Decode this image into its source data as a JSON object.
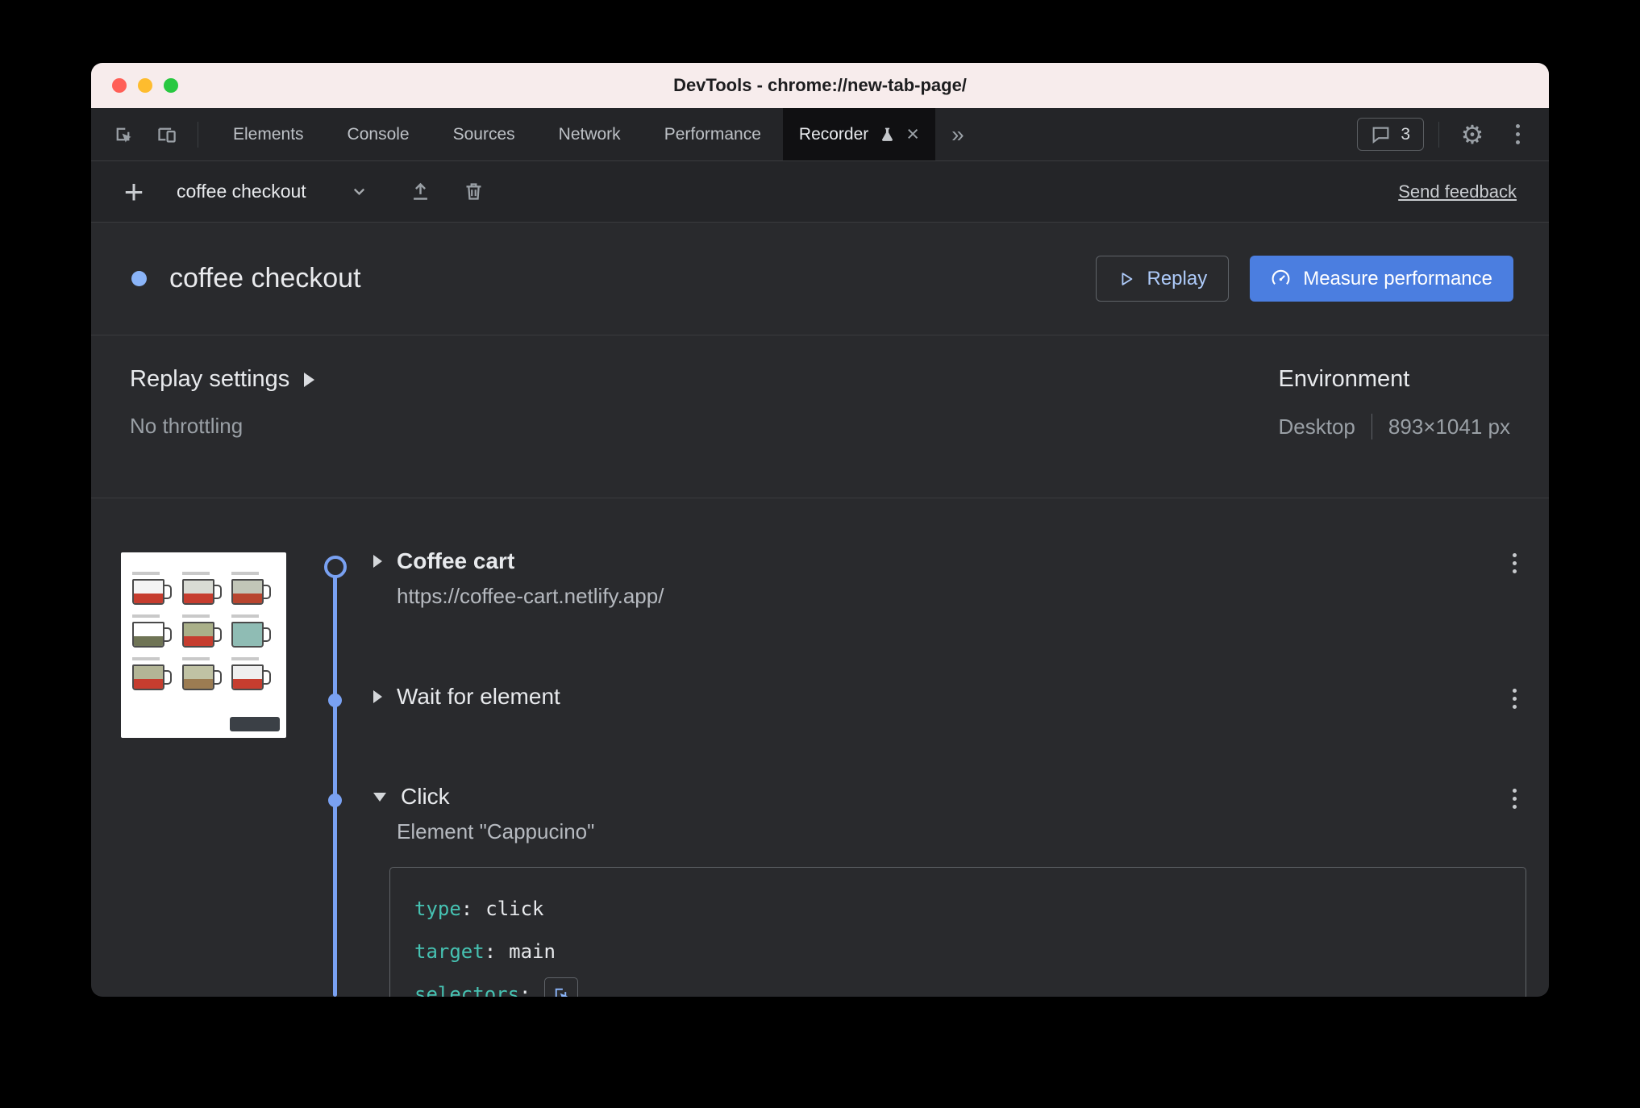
{
  "colors": {
    "accent_blue": "#8ab4f8",
    "primary_button": "#4b7ee0",
    "timeline_blue": "#79a1f2",
    "key_teal": "#46c2b2",
    "titlebar_bg": "#f7ecec",
    "traffic_red": "#ff5f57",
    "traffic_yellow": "#febc2e",
    "traffic_green": "#28c840"
  },
  "window": {
    "title": "DevTools - chrome://new-tab-page/"
  },
  "icons": {
    "add": "+",
    "more_tabs": "»",
    "close_tab": "×",
    "gear": "⚙"
  },
  "tabbar": {
    "tabs": [
      "Elements",
      "Console",
      "Sources",
      "Network",
      "Performance"
    ],
    "active_tab": "Recorder",
    "message_count": "3"
  },
  "toolbar": {
    "recording_name": "coffee checkout",
    "send_feedback": "Send feedback"
  },
  "header": {
    "title": "coffee checkout",
    "replay": "Replay",
    "measure": "Measure performance"
  },
  "settings": {
    "replay_settings": "Replay settings",
    "throttling": "No throttling",
    "environment": "Environment",
    "device": "Desktop",
    "dimensions": "893×1041 px"
  },
  "steps": [
    {
      "name": "Coffee cart",
      "detail": "https://coffee-cart.netlify.app/"
    },
    {
      "name": "Wait for element",
      "detail": ""
    },
    {
      "name": "Click",
      "detail": "Element \"Cappucino\""
    }
  ],
  "code": {
    "separator": ":",
    "lines": [
      {
        "key": "type",
        "value": "click"
      },
      {
        "key": "target",
        "value": "main"
      },
      {
        "key": "selectors",
        "value": ""
      }
    ]
  }
}
